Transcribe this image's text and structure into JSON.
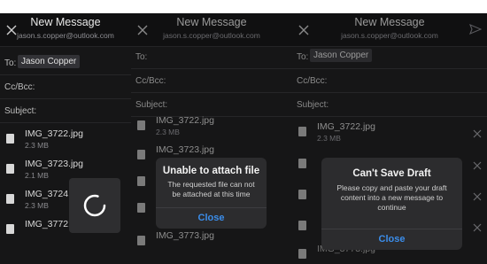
{
  "panels": [
    {
      "header": {
        "title": "New Message",
        "email": "jason.s.copper@outlook.com"
      },
      "fields": {
        "to_label": "To:",
        "to_chip": "Jason Copper",
        "ccbcc_label": "Cc/Bcc:",
        "subject_label": "Subject:"
      },
      "attachments": [
        {
          "name": "IMG_3722.jpg",
          "size": "2.3 MB"
        },
        {
          "name": "IMG_3723.jpg",
          "size": "2.1 MB"
        },
        {
          "name": "IMG_3724.",
          "size": "2.3 MB"
        },
        {
          "name": "IMG_3772.jpg",
          "size": ""
        }
      ]
    },
    {
      "header": {
        "title": "New Message",
        "email": "jason.s.copper@outlook.com"
      },
      "fields": {
        "to_label": "To:",
        "ccbcc_label": "Cc/Bcc:",
        "subject_label": "Subject:"
      },
      "attachments": [
        {
          "name": "IMG_3722.jpg",
          "size": "2.3 MB"
        },
        {
          "name": "IMG_3723.jpg",
          "size": ""
        },
        {
          "name": "IMG_3773.jpg",
          "size": ""
        }
      ],
      "alert": {
        "title": "Unable to attach file",
        "message": "The requested file can not be attached at this time",
        "button": "Close"
      }
    },
    {
      "header": {
        "title": "New Message",
        "email": "jason.s.copper@outlook.com"
      },
      "fields": {
        "to_label": "To:",
        "to_chip": "Jason Copper",
        "ccbcc_label": "Cc/Bcc:",
        "subject_label": "Subject:"
      },
      "attachments": [
        {
          "name": "IMG_3722.jpg",
          "size": "2.3 MB"
        },
        {
          "name": "IMG_3773.jpg",
          "size": ""
        }
      ],
      "alert": {
        "title": "Can't Save Draft",
        "message": "Please copy and paste your draft content into a new message to continue",
        "button": "Close"
      }
    }
  ],
  "colors": {
    "background": "#161617",
    "alert": "#2c2c2e",
    "accent": "#3b8dea"
  },
  "icons": [
    "close-icon",
    "send-icon",
    "attachment-thumbnail-icon",
    "remove-attachment-icon",
    "loading-spinner-icon"
  ]
}
